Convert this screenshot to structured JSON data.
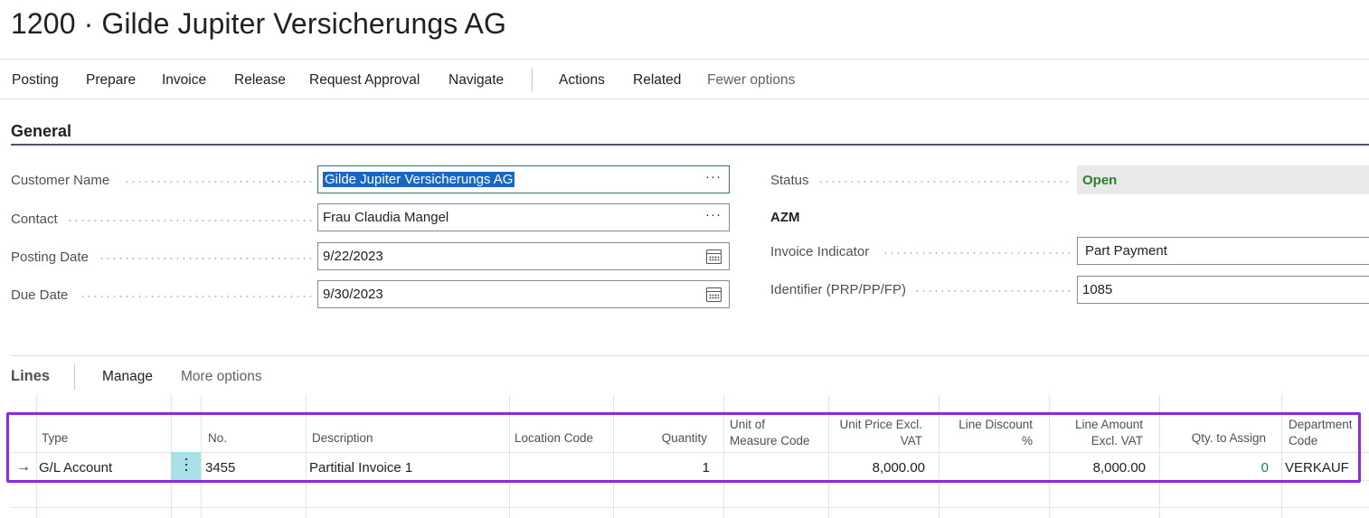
{
  "page": {
    "title": "1200 · Gilde Jupiter Versicherungs AG"
  },
  "actions": {
    "items": [
      "Posting",
      "Prepare",
      "Invoice",
      "Release",
      "Request Approval",
      "Navigate"
    ],
    "secondary": [
      "Actions",
      "Related"
    ],
    "fewer_options": "Fewer options"
  },
  "general": {
    "title": "General",
    "customer_name": {
      "label": "Customer Name",
      "value": "Gilde Jupiter Versicherungs AG"
    },
    "contact": {
      "label": "Contact",
      "value": "Frau Claudia Mangel"
    },
    "posting_date": {
      "label": "Posting Date",
      "value": "9/22/2023"
    },
    "due_date": {
      "label": "Due Date",
      "value": "9/30/2023"
    },
    "status": {
      "label": "Status",
      "value": "Open",
      "color": "#2f7d2f"
    },
    "group_title": "AZM",
    "invoice_indicator": {
      "label": "Invoice Indicator",
      "value": "Part Payment"
    },
    "identifier": {
      "label": "Identifier (PRP/PP/FP)",
      "value": "1085"
    }
  },
  "lines": {
    "title": "Lines",
    "manage": "Manage",
    "more_options": "More options",
    "columns": {
      "type": "Type",
      "no": "No.",
      "description": "Description",
      "location_code": "Location Code",
      "quantity": "Quantity",
      "uom_1": "Unit of",
      "uom_2": "Measure Code",
      "unit_price_1": "Unit Price Excl.",
      "unit_price_2": "VAT",
      "line_discount_1": "Line Discount",
      "line_discount_2": "%",
      "line_amount_1": "Line Amount",
      "line_amount_2": "Excl. VAT",
      "qty_to_assign": "Qty. to Assign",
      "department_1": "Department",
      "department_2": "Code"
    },
    "rows": [
      {
        "type": "G/L Account",
        "no": "3455",
        "description": "Partitial Invoice 1",
        "location_code": "",
        "quantity": "1",
        "uom": "",
        "unit_price": "8,000.00",
        "line_discount": "",
        "line_amount": "8,000.00",
        "qty_to_assign": "0",
        "department": "VERKAUF"
      }
    ]
  },
  "colors": {
    "highlight": "#8a2be2",
    "accent_selection": "#1a66c4",
    "rule": "#4a5472"
  }
}
